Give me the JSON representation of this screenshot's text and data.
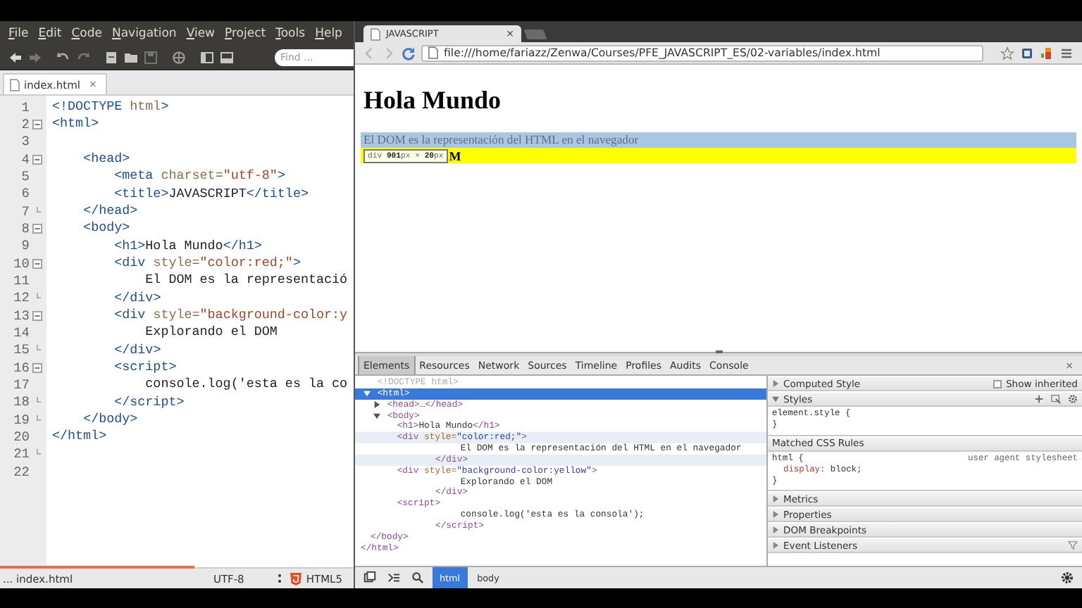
{
  "editor": {
    "menu": [
      "File",
      "Edit",
      "Code",
      "Navigation",
      "View",
      "Project",
      "Tools",
      "Help"
    ],
    "find": {
      "placeholder": "Find ..."
    },
    "tab": {
      "label": "index.html",
      "close": "×",
      "selected": true
    },
    "lines": [
      {
        "number": "1",
        "text": "<!DOCTYPE html>",
        "kind": "plain"
      },
      {
        "number": "2",
        "text": "<html>",
        "kind": "fold-start"
      },
      {
        "number": "3",
        "kind": "plain"
      },
      {
        "number": "4",
        "text": "    <head>",
        "kind": "fold-start"
      },
      {
        "number": "5",
        "text": "        <meta charset=\"utf-8\">",
        "kind": "plain"
      },
      {
        "number": "6",
        "text": "        <title>JAVASCRIPT</title>",
        "kind": "plain"
      },
      {
        "number": "7",
        "text": "    </head>",
        "kind": "fold-end"
      },
      {
        "number": "8",
        "text": "    <body>",
        "kind": "fold-start"
      },
      {
        "number": "9",
        "text": "        <h1>Hola Mundo</h1>",
        "kind": "plain"
      },
      {
        "number": "10",
        "text": "        <div style=\"color:red;\">",
        "kind": "fold-start"
      },
      {
        "number": "11",
        "text": "            El DOM es la representació",
        "kind": "plain"
      },
      {
        "number": "12",
        "text": "        </div>",
        "kind": "fold-end"
      },
      {
        "number": "13",
        "text": "        <div style=\"background-color:y",
        "kind": "fold-start"
      },
      {
        "number": "14",
        "text": "            Explorando el DOM",
        "kind": "plain"
      },
      {
        "number": "15",
        "text": "        </div>",
        "kind": "fold-end"
      },
      {
        "number": "16",
        "text": "        <script>",
        "kind": "fold-start"
      },
      {
        "number": "17",
        "text": "            console.log('esta es la co",
        "kind": "plain"
      },
      {
        "number": "18",
        "text": "        </script>",
        "kind": "fold-end"
      },
      {
        "number": "19",
        "text": "    </body>",
        "kind": "fold-end"
      },
      {
        "number": "20",
        "text": "</html>",
        "kind": "plain"
      },
      {
        "number": "21",
        "kind": "fold-end"
      },
      {
        "number": "22",
        "kind": "plain"
      }
    ],
    "status": {
      "file": "... index.html",
      "encoding": "UTF-8",
      "language": "HTML5"
    }
  },
  "browser": {
    "tab": {
      "title": "JAVASCRIPT",
      "close": "×"
    },
    "address": "file:///home/fariazz/Zenwa/Courses/PFE_JAVASCRIPT_ES/02-variables/index.html",
    "page": {
      "heading": "Hola Mundo",
      "paragraph": "El DOM es la representación del HTML en el navegador",
      "highlighted": true,
      "yellow_text": "M",
      "tooltip": "div **901**px × **20**px"
    }
  },
  "devtools": {
    "tabs": [
      {
        "label": "Elements",
        "selected": true
      },
      {
        "label": "Resources",
        "selected": false
      },
      {
        "label": "Network",
        "selected": false
      },
      {
        "label": "Sources",
        "selected": false
      },
      {
        "label": "Timeline",
        "selected": false
      },
      {
        "label": "Profiles",
        "selected": false
      },
      {
        "label": "Audits",
        "selected": false
      },
      {
        "label": "Console",
        "selected": false
      }
    ],
    "close": "×",
    "tree": [
      {
        "kind": "doctype",
        "text": "<!DOCTYPE html>",
        "selected": false
      },
      {
        "kind": "element",
        "text": "<html>",
        "selected": true,
        "expanded": true,
        "close": "</html>",
        "children": [
          {
            "kind": "element",
            "text": "<head>…</head>",
            "selected": false,
            "expanded": false
          },
          {
            "kind": "element",
            "text": "<body>",
            "selected": false,
            "expanded": true,
            "close": "</body>",
            "children": [
              {
                "kind": "element",
                "text": "<h1>Hola Mundo</h1>",
                "selected": false
              },
              {
                "kind": "element",
                "text": "<div style=\"color:red;\">",
                "selected": false,
                "hovered": true,
                "close": "</div>",
                "children": [
                  {
                    "kind": "text",
                    "text": "El DOM es la representación del HTML en el navegador",
                    "selected": false
                  }
                ]
              },
              {
                "kind": "element",
                "text": "<div style=\"background-color:yellow\">",
                "selected": false,
                "hovered": false,
                "close": "</div>",
                "children": [
                  {
                    "kind": "text",
                    "text": "Explorando el DOM",
                    "selected": false
                  }
                ]
              },
              {
                "kind": "element",
                "text": "<script>",
                "selected": false,
                "close": "</script>",
                "children": [
                  {
                    "kind": "text",
                    "text": "console.log('esta es la consola');",
                    "selected": false
                  }
                ]
              }
            ]
          }
        ]
      }
    ],
    "sidebar": [
      {
        "kind": "computed",
        "title": "Computed Style",
        "expanded": false,
        "option": {
          "label": "Show inherited",
          "checked": false
        }
      },
      {
        "kind": "styles",
        "title": "Styles",
        "expanded": true,
        "lines": [
          "element.style {",
          "}"
        ]
      },
      {
        "kind": "rules",
        "title": "Matched CSS Rules",
        "selector": "html {",
        "origin": "user agent stylesheet",
        "declaration": "display: block;",
        "end": "}"
      },
      {
        "kind": "section",
        "title": "Metrics",
        "expanded": false
      },
      {
        "kind": "section",
        "title": "Properties",
        "expanded": false
      },
      {
        "kind": "section",
        "title": "DOM Breakpoints",
        "expanded": false
      },
      {
        "kind": "listeners",
        "title": "Event Listeners",
        "expanded": false
      }
    ],
    "breadcrumbs": [
      {
        "label": "html",
        "selected": true
      },
      {
        "label": "body",
        "selected": false
      }
    ]
  }
}
